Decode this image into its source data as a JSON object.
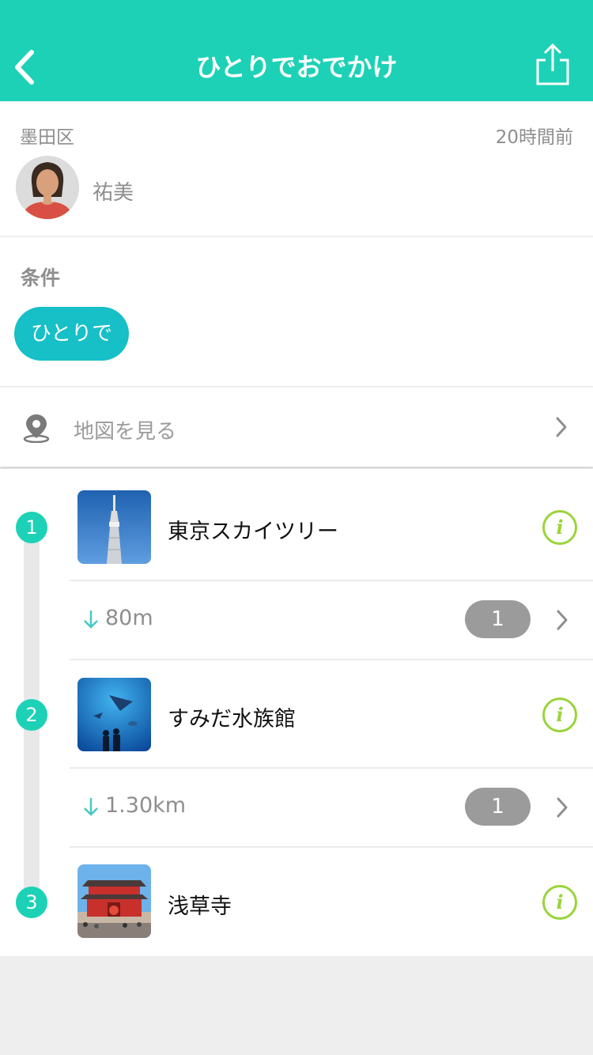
{
  "header": {
    "title": "ひとりでおでかけ"
  },
  "post": {
    "district": "墨田区",
    "time_ago": "20時間前",
    "user_name": "祐美"
  },
  "conditions": {
    "label": "条件",
    "tags": [
      "ひとりで"
    ]
  },
  "map": {
    "label": "地図を見る"
  },
  "spots": [
    {
      "number": "1",
      "name": "東京スカイツリー"
    },
    {
      "number": "2",
      "name": "すみだ水族館"
    },
    {
      "number": "3",
      "name": "浅草寺"
    }
  ],
  "legs": [
    {
      "distance": "80m",
      "count": "1"
    },
    {
      "distance": "1.30km",
      "count": "1"
    }
  ],
  "colors": {
    "header": "#1dd1b6",
    "chip": "#17bfc7",
    "info": "#9ad43b",
    "badge": "#9b9b9b"
  }
}
